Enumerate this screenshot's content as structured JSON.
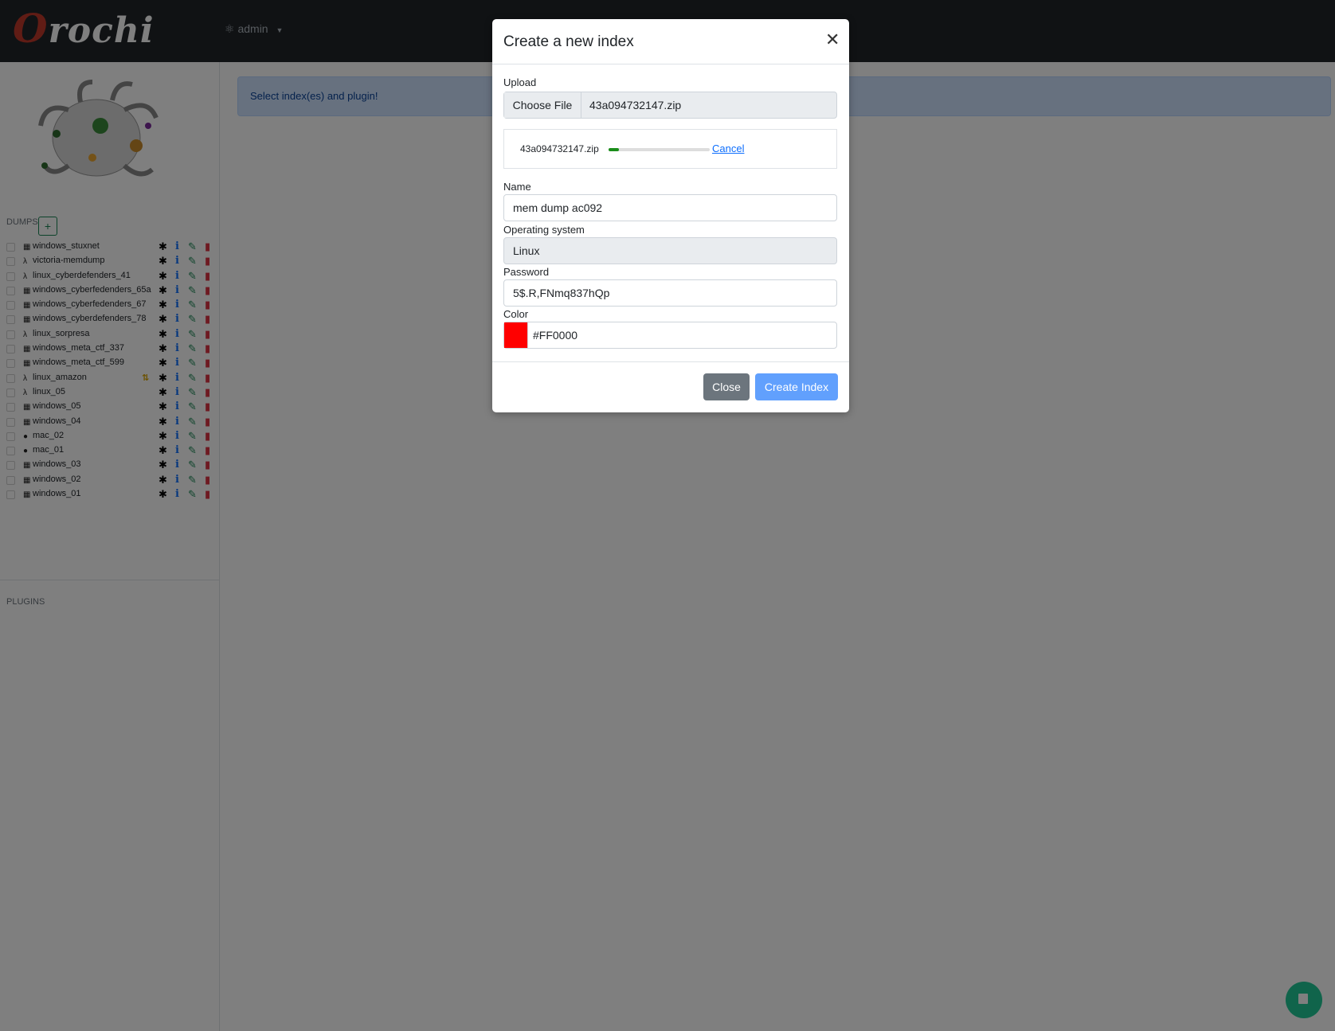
{
  "navbar": {
    "brand": "Orochi",
    "brand_initial": "O",
    "brand_rest": "rochi",
    "user_name": "admin",
    "user_icon": "user-secret-icon"
  },
  "sidebar": {
    "dumps_label": "DUMPS",
    "add_label": "+",
    "plugins_label": "PLUGINS",
    "dumps": [
      {
        "os": "windows",
        "name": "windows_stuxnet",
        "warn": false
      },
      {
        "os": "linux",
        "name": "victoria-memdump",
        "warn": false
      },
      {
        "os": "linux",
        "name": "linux_cyberdefenders_41",
        "warn": false
      },
      {
        "os": "windows",
        "name": "windows_cyberfedenders_65a",
        "warn": false
      },
      {
        "os": "windows",
        "name": "windows_cyberfedenders_67",
        "warn": false
      },
      {
        "os": "windows",
        "name": "windows_cyberdefenders_78",
        "warn": false
      },
      {
        "os": "linux",
        "name": "linux_sorpresa",
        "warn": false
      },
      {
        "os": "windows",
        "name": "windows_meta_ctf_337",
        "warn": false
      },
      {
        "os": "windows",
        "name": "windows_meta_ctf_599",
        "warn": false
      },
      {
        "os": "linux",
        "name": "linux_amazon",
        "warn": true
      },
      {
        "os": "linux",
        "name": "linux_05",
        "warn": false
      },
      {
        "os": "windows",
        "name": "windows_05",
        "warn": false
      },
      {
        "os": "windows",
        "name": "windows_04",
        "warn": false
      },
      {
        "os": "mac",
        "name": "mac_02",
        "warn": false
      },
      {
        "os": "mac",
        "name": "mac_01",
        "warn": false
      },
      {
        "os": "windows",
        "name": "windows_03",
        "warn": false
      },
      {
        "os": "windows",
        "name": "windows_02",
        "warn": false
      },
      {
        "os": "windows",
        "name": "windows_01",
        "warn": false
      }
    ]
  },
  "main": {
    "alert_text": "Select index(es) and plugin!"
  },
  "modal": {
    "title": "Create a new index",
    "upload_label": "Upload",
    "choose_file_label": "Choose File",
    "file_name": "43a094732147.zip",
    "upload_progress_name": "43a094732147.zip",
    "upload_progress_fraction": 0.1,
    "upload_cancel_label": "Cancel",
    "name_label": "Name",
    "name_value": "mem dump ac092",
    "os_label": "Operating system",
    "os_value": "Linux",
    "password_label": "Password",
    "password_value": "5$.R,FNmq837hQp",
    "color_label": "Color",
    "color_value": "#FF0000",
    "close_label": "Close",
    "create_label": "Create Index"
  },
  "colors": {
    "navbar": "#212529",
    "primary": "#0d6efd",
    "success": "#198754",
    "danger": "#dc3545",
    "alert_bg": "#cfe2ff",
    "fab": "#20c997"
  }
}
